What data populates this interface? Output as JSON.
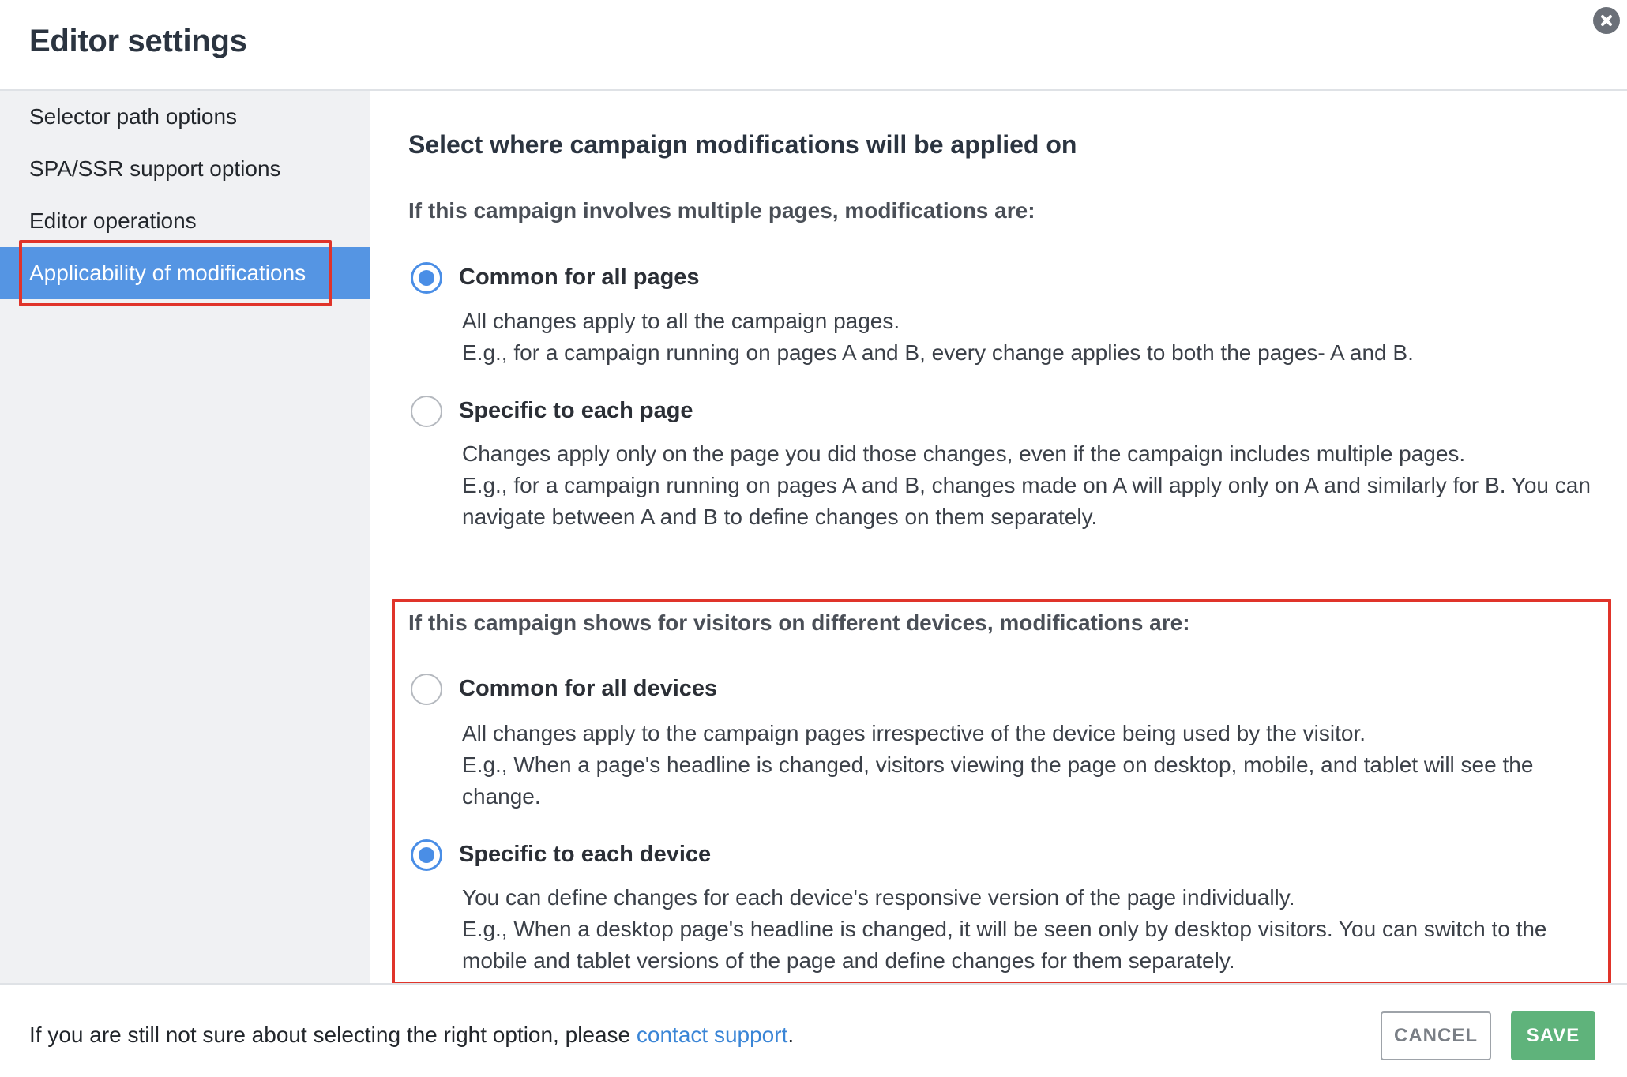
{
  "dialog": {
    "title": "Editor settings",
    "close_icon": "close-icon"
  },
  "sidebar": {
    "items": [
      {
        "label": "Selector path options",
        "active": false
      },
      {
        "label": "SPA/SSR support options",
        "active": false
      },
      {
        "label": "Editor operations",
        "active": false
      },
      {
        "label": "Applicability of modifications",
        "active": true
      }
    ]
  },
  "main": {
    "title": "Select where campaign modifications will be applied on",
    "pages_section": {
      "question": "If this campaign involves multiple pages, modifications are:",
      "options": [
        {
          "label": "Common for all pages",
          "checked": true,
          "desc_line1": "All changes apply to all the campaign pages.",
          "desc_line2": "E.g., for a campaign running on pages A and B, every change applies to both the pages- A and B."
        },
        {
          "label": "Specific to each page",
          "checked": false,
          "desc_line1": "Changes apply only on the page you did those changes, even if the campaign includes multiple pages.",
          "desc_line2": "E.g., for a campaign running on pages A and B, changes made on A will apply only on A and similarly for B. You can navigate between A and B to define changes on them separately."
        }
      ]
    },
    "devices_section": {
      "question": "If this campaign shows for visitors on different devices, modifications are:",
      "options": [
        {
          "label": "Common for all devices",
          "checked": false,
          "desc_line1": "All changes apply to the campaign pages irrespective of the device being used by the visitor.",
          "desc_line2": "E.g., When a page's headline is changed, visitors viewing the page on desktop, mobile, and tablet will see the change."
        },
        {
          "label": "Specific to each device",
          "checked": true,
          "desc_line1": "You can define changes for each device's responsive version of the page individually.",
          "desc_line2": "E.g., When a desktop page's headline is changed, it will be seen only by desktop visitors. You can switch to the mobile and tablet versions of the page and define changes for them separately."
        }
      ]
    }
  },
  "footer": {
    "text_before": "If you are still not sure about selecting the right option, please ",
    "link_text": "contact support",
    "text_after": ".",
    "cancel_label": "CANCEL",
    "save_label": "SAVE"
  },
  "colors": {
    "accent": "#4a8ee6",
    "active_sidebar": "#5595e3",
    "highlight": "#e0342a",
    "save": "#5fb37b",
    "link": "#3a85d6"
  }
}
